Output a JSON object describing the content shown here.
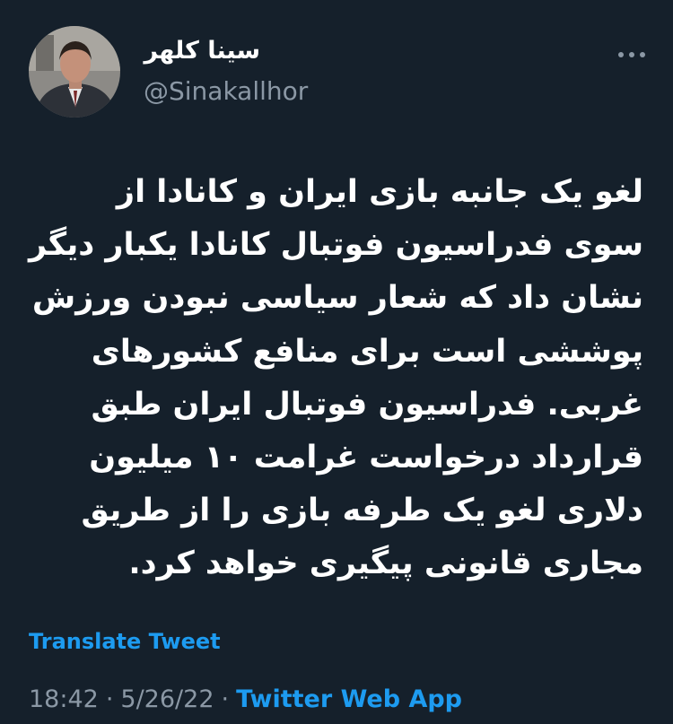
{
  "author": {
    "display_name": "سینا کلهر",
    "handle": "@Sinakallhor"
  },
  "tweet": {
    "lines": [
      "لغو یک جانبه بازی ایران و کانادا از",
      "سوی فدراسیون فوتبال کانادا یکبار دیگر",
      "نشان داد که شعار سیاسی نبودن ورزش",
      "پوششی است برای منافع کشورهای",
      "غربی. فدراسیون فوتبال ایران طبق",
      "قرارداد درخواست غرامت ۱۰ میلیون",
      "دلاری لغو یک طرفه بازی را از طریق",
      "مجاری قانونی پیگیری خواهد کرد."
    ],
    "translate_label": "Translate Tweet"
  },
  "meta": {
    "time": "18:42",
    "separator": "·",
    "date": "5/26/22",
    "source": "Twitter Web App"
  },
  "colors": {
    "background": "#15202b",
    "text_primary": "#ffffff",
    "text_secondary": "#8b98a5",
    "accent": "#1d9bf0"
  },
  "icons": {
    "more": "more-horizontal-icon",
    "avatar": "profile-photo"
  }
}
